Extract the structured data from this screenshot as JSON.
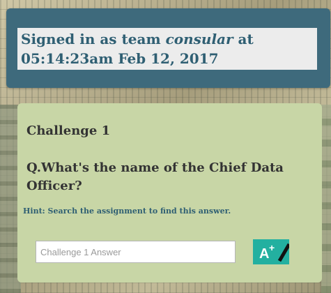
{
  "header": {
    "signin_prefix": "Signed in as team ",
    "team_name": "consular",
    "signin_suffix": " at",
    "timestamp": "05:14:23am Feb 12, 2017"
  },
  "challenge": {
    "title": "Challenge 1",
    "question": "Q.What's the name of the Chief Data Officer?",
    "hint": "Hint: Search the assignment to find this answer.",
    "answer_placeholder": "Challenge 1 Answer",
    "answer_value": "",
    "submit_icon": "a-plus-grade-icon",
    "submit_label": "A"
  },
  "colors": {
    "header_bg": "#3e6a7c",
    "signin_text": "#2f5f73",
    "card_bg": "#c8d6a6",
    "submit_bg": "#23b0a0"
  }
}
